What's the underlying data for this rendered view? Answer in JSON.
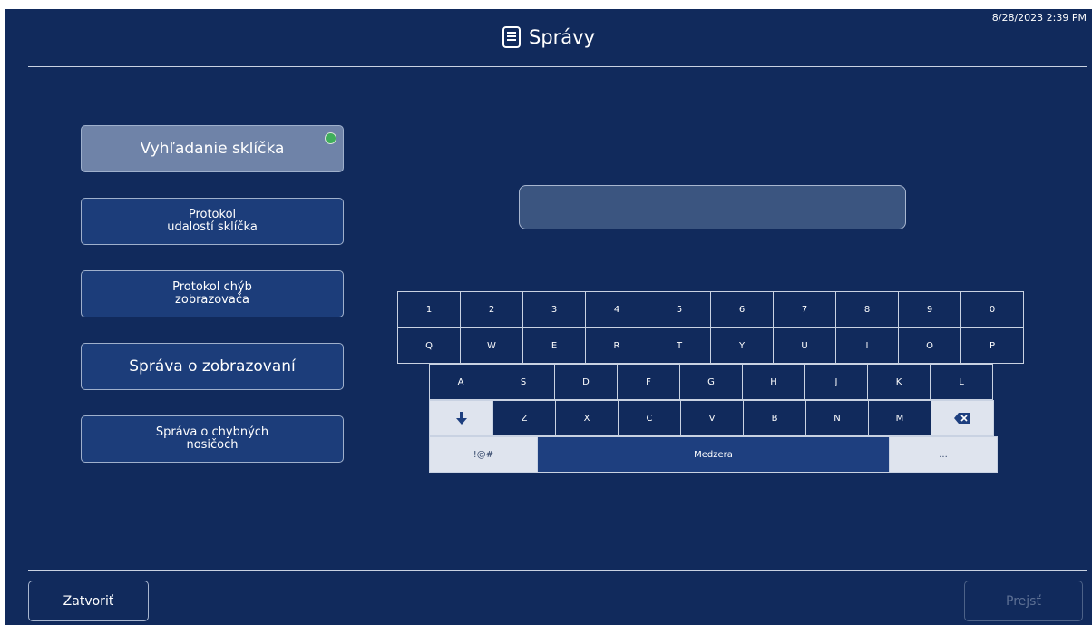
{
  "header": {
    "timestamp": "8/28/2023 2:39 PM",
    "title": "Správy",
    "title_icon": "document-icon"
  },
  "menu": [
    {
      "label": "Vyhľadanie sklíčka",
      "active": true,
      "status": "green"
    },
    {
      "label": "Protokol\nudalostí sklíčka"
    },
    {
      "label": "Protokol chýb\nzobrazovača"
    },
    {
      "label": "Správa o zobrazovaní"
    },
    {
      "label": "Správa o chybných\nnosičoch"
    }
  ],
  "search": {
    "value": "",
    "placeholder": ""
  },
  "keyboard": {
    "row1": [
      "1",
      "2",
      "3",
      "4",
      "5",
      "6",
      "7",
      "8",
      "9",
      "0"
    ],
    "row2": [
      "Q",
      "W",
      "E",
      "R",
      "T",
      "Y",
      "U",
      "I",
      "O",
      "P"
    ],
    "row3": [
      "A",
      "S",
      "D",
      "F",
      "G",
      "H",
      "J",
      "K",
      "L"
    ],
    "row4": [
      "Z",
      "X",
      "C",
      "V",
      "B",
      "N",
      "M"
    ],
    "shift_icon": "arrow-down-icon",
    "backspace_icon": "backspace-icon",
    "symbols_label": "!@#",
    "space_label": "Medzera",
    "ellipsis_label": "..."
  },
  "footer": {
    "close_label": "Zatvoriť",
    "go_label": "Prejsť"
  },
  "colors": {
    "background": "#112a5c",
    "button": "#1c3d7a",
    "active_button": "#6f83a8",
    "status_green": "#3fae5b",
    "light_key": "#dfe4ee"
  }
}
